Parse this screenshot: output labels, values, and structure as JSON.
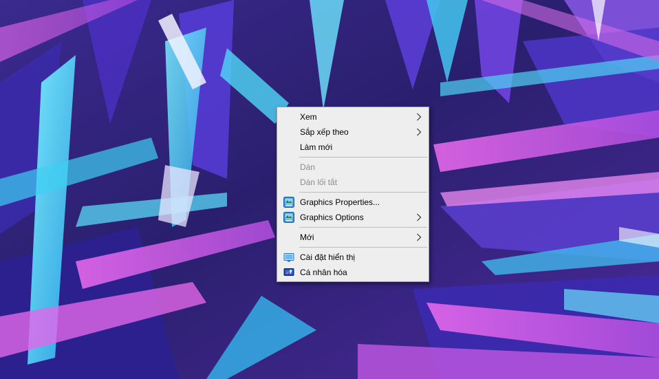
{
  "context_menu": {
    "items": [
      {
        "label": "Xem",
        "submenu": true,
        "enabled": true
      },
      {
        "label": "Sắp xếp theo",
        "submenu": true,
        "enabled": true
      },
      {
        "label": "Làm mới",
        "submenu": false,
        "enabled": true
      },
      {
        "label": "Dán",
        "submenu": false,
        "enabled": false
      },
      {
        "label": "Dán lối tắt",
        "submenu": false,
        "enabled": false
      },
      {
        "label": "Graphics Properties...",
        "submenu": false,
        "enabled": true,
        "icon": "intel-graphics-icon"
      },
      {
        "label": "Graphics Options",
        "submenu": true,
        "enabled": true,
        "icon": "intel-graphics-icon"
      },
      {
        "label": "Mới",
        "submenu": true,
        "enabled": true
      },
      {
        "label": "Cài đặt hiển thị",
        "submenu": false,
        "enabled": true,
        "icon": "display-settings-icon"
      },
      {
        "label": "Cá nhân hóa",
        "submenu": false,
        "enabled": true,
        "icon": "personalize-icon"
      }
    ]
  },
  "colors": {
    "menu_background": "#eeeeee",
    "menu_border": "#a0a0a0",
    "text": "#000000",
    "disabled_text": "#8c8c8c",
    "separator": "#bdbdbd",
    "wallpaper_base": "#2a1f6e",
    "wallpaper_cyan": "#3ad4f2",
    "wallpaper_magenta": "#d24fd8",
    "wallpaper_purple": "#6a3de0"
  }
}
